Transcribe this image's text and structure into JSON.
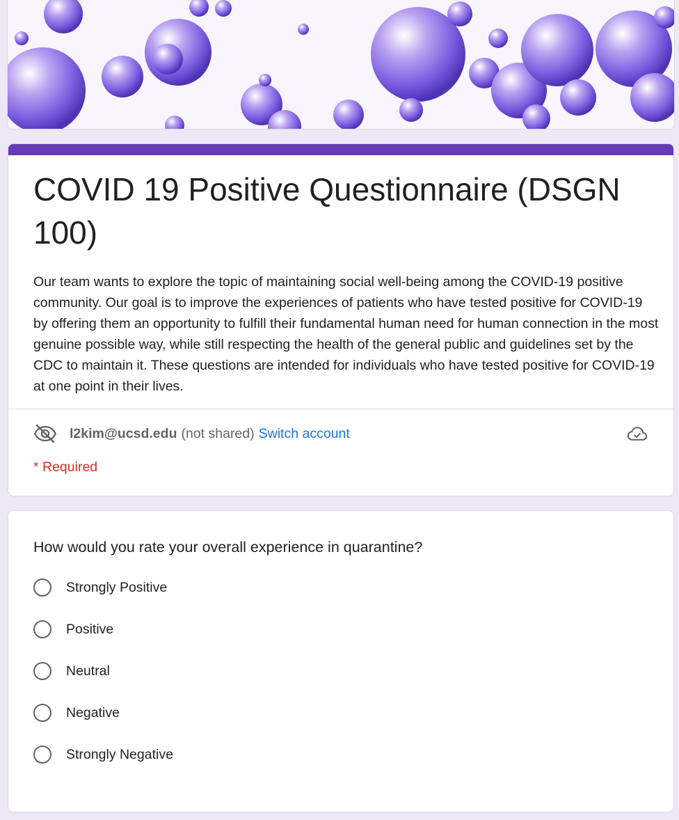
{
  "form": {
    "title": "COVID 19 Positive Questionnaire (DSGN 100)",
    "description": "Our team wants to explore the topic of maintaining social well-being among the COVID-19 positive community. Our goal is to improve the experiences of patients who have tested positive for COVID-19 by offering them an opportunity to fulfill their fundamental human need for human connection in the most genuine possible way, while still respecting the health of the general public and guidelines set by the CDC to maintain it. These questions are intended for individuals who have tested positive for COVID-19 at one point in their lives.",
    "accent_color": "#673ab7",
    "background_color": "#ede7f6"
  },
  "account": {
    "email": "l2kim@ucsd.edu",
    "not_shared": "(not shared)",
    "switch_label": "Switch account",
    "privacy_icon": "eye-off-icon",
    "cloud_icon": "cloud-done-icon"
  },
  "required_note": "* Required",
  "question": {
    "text": "How would you rate your overall experience in quarantine?",
    "options": [
      {
        "label": "Strongly Positive"
      },
      {
        "label": "Positive"
      },
      {
        "label": "Neutral"
      },
      {
        "label": "Negative"
      },
      {
        "label": "Strongly Negative"
      }
    ]
  }
}
